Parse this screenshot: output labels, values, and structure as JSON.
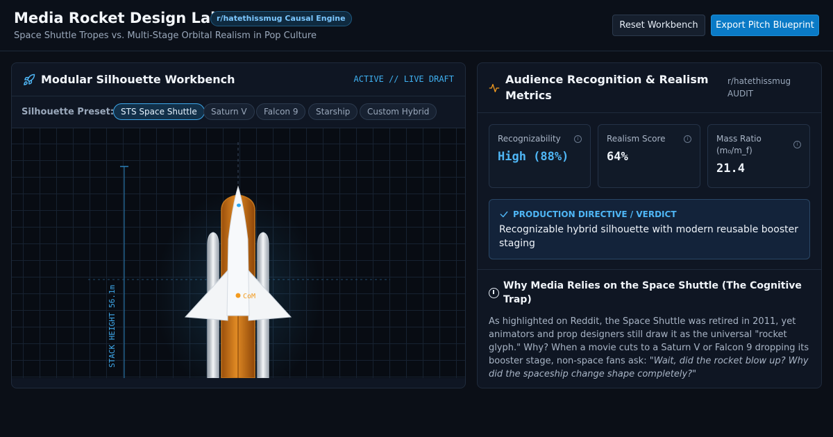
{
  "header": {
    "title": "Media Rocket Design Lab",
    "engine_badge": "r/hatethissmug Causal Engine",
    "subtitle": "Space Shuttle Tropes vs. Multi-Stage Orbital Realism in Pop Culture",
    "reset_label": "Reset Workbench",
    "export_label": "Export Pitch Blueprint"
  },
  "workbench": {
    "icon": "rocket-icon",
    "title": "Modular Silhouette Workbench",
    "status": "ACTIVE // LIVE DRAFT",
    "preset_label": "Silhouette Preset:",
    "presets": [
      "STS Space Shuttle",
      "Saturn V",
      "Falcon 9",
      "Starship",
      "Custom Hybrid"
    ],
    "active_preset": "STS Space Shuttle",
    "stack_height_label": "STACK HEIGHT 56.1m",
    "com_label": "CoM"
  },
  "metrics_panel": {
    "icon": "pulse-icon",
    "title": "Audience Recognition & Realism Metrics",
    "tag_line1": "r/hatethissmug",
    "tag_line2": "AUDIT",
    "metrics": [
      {
        "label": "Recognizability",
        "value": "High (88%)",
        "color": "#4fb6f5"
      },
      {
        "label": "Realism Score",
        "value": "64%",
        "color": "#eef3f9"
      },
      {
        "label": "Mass Ratio (m₀/m_f)",
        "value": "21.4",
        "color": "#eef3f9"
      }
    ],
    "directive_heading": "PRODUCTION DIRECTIVE / VERDICT",
    "directive_text": "Recognizable hybrid silhouette with modern reusable booster staging",
    "why_title": "Why Media Relies on the Space Shuttle (The Cognitive Trap)",
    "why_body_plain": "As highlighted on Reddit, the Space Shuttle was retired in 2011, yet animators and prop designers still draw it as the universal \"rocket glyph.\" Why? When a movie cuts to a Saturn V or Falcon 9 dropping its booster stage, non-space fans ask: ",
    "why_body_italic": "\"Wait, did the rocket blow up? Why did the spaceship change shape completely?\""
  }
}
